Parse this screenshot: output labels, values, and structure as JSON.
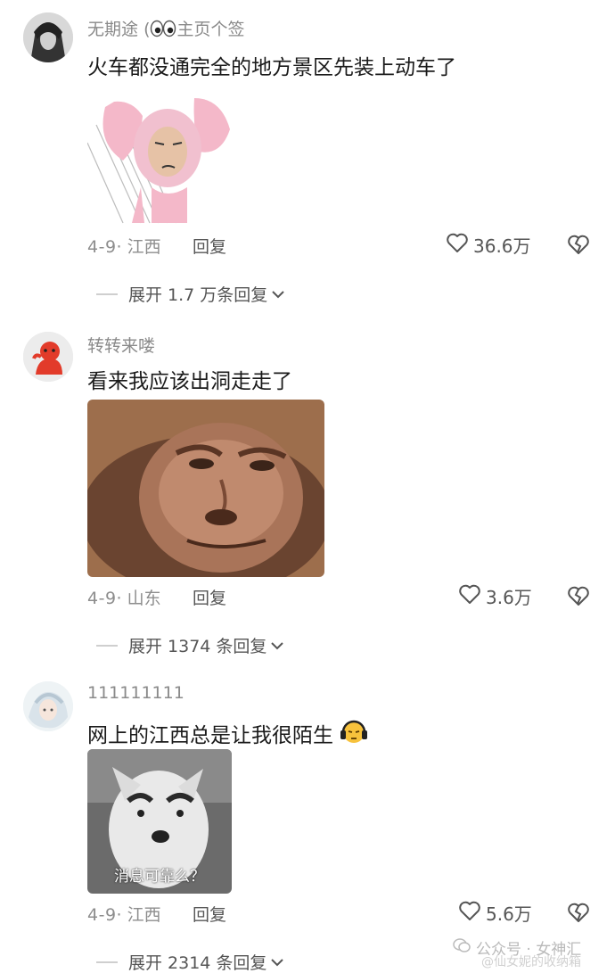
{
  "comments": [
    {
      "username": "无期途",
      "username_suffix": "主页个签",
      "text": "火车都没通完全的地方景区先装上动车了",
      "date": "4-9",
      "location": "江西",
      "reply_label": "回复",
      "likes": "36.6万",
      "expand_label": "展开 1.7 万条回复",
      "sticker_desc": "pink-rabbit-meme"
    },
    {
      "username": "转转来喽",
      "text": "看来我应该出洞走走了",
      "date": "4-9",
      "location": "山东",
      "reply_label": "回复",
      "likes": "3.6万",
      "expand_label": "展开 1374 条回复",
      "sticker_desc": "monkey-face-meme"
    },
    {
      "username": "111111111",
      "text": "网上的江西总是让我很陌生",
      "date": "4-9",
      "location": "江西",
      "reply_label": "回复",
      "likes": "5.6万",
      "expand_label": "展开 2314 条回复",
      "sticker_caption": "消息可靠么？",
      "sticker_desc": "dog-with-eyebrows-meme"
    }
  ],
  "watermark": {
    "text": "公众号 · 女神汇",
    "secondary": "@仙女妮的收纳箱"
  },
  "colors": {
    "meta_gray": "#8d8d8d",
    "text": "#1a1a1a",
    "icon": "#555555"
  }
}
